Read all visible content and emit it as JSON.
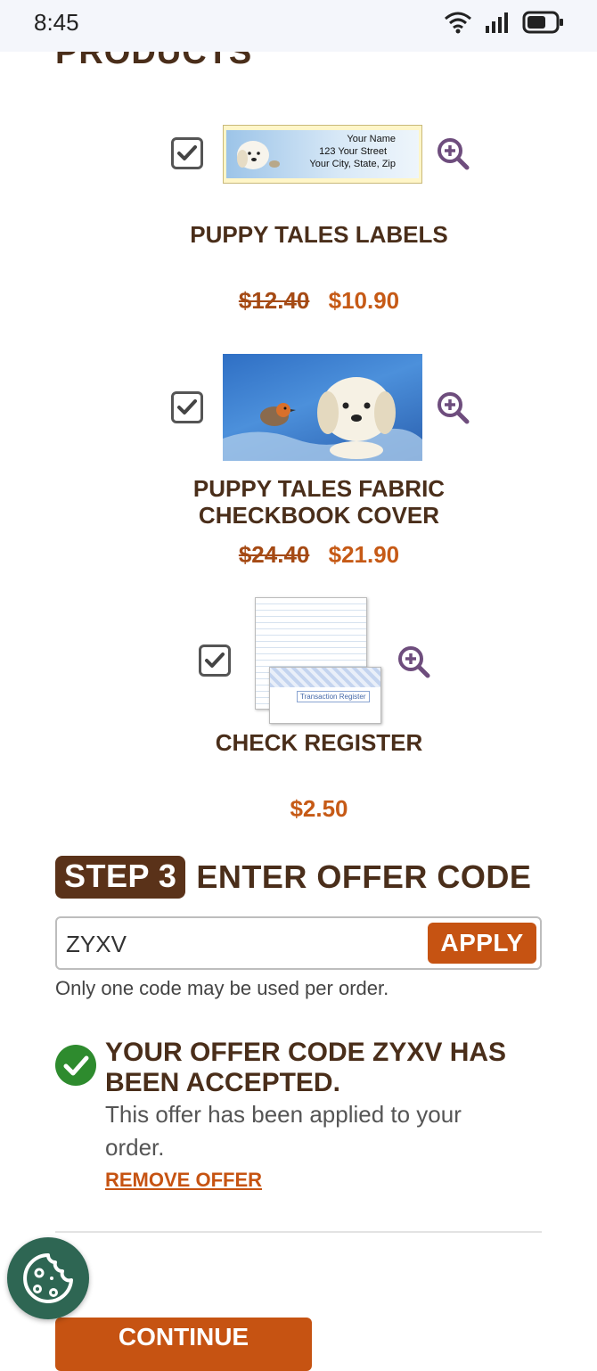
{
  "status": {
    "time": "8:45",
    "icons": [
      "wifi-icon",
      "signal-icon",
      "battery-icon"
    ]
  },
  "section": {
    "title": "PRODUCTS"
  },
  "products": [
    {
      "name": "PUPPY TALES LABELS",
      "old_price": "$12.40",
      "new_price": "$10.90",
      "checked": true,
      "label_lines": [
        "Your Name",
        "123 Your Street",
        "Your City, State, Zip"
      ]
    },
    {
      "name_line1": "PUPPY TALES FABRIC",
      "name_line2": "CHECKBOOK COVER",
      "old_price": "$24.40",
      "new_price": "$21.90",
      "checked": true
    },
    {
      "name": "CHECK REGISTER",
      "price": "$2.50",
      "checked": true,
      "register_caption": "Transaction Register"
    }
  ],
  "step3": {
    "badge": "STEP 3",
    "title": "ENTER OFFER CODE",
    "input_value": "ZYXV",
    "apply_label": "APPLY",
    "note": "Only one code may be used per order."
  },
  "offer": {
    "title": "YOUR OFFER CODE ZYXV HAS BEEN ACCEPTED.",
    "message": "This offer has been applied to your order.",
    "remove_label": "REMOVE OFFER"
  },
  "continue_label": "CONTINUE",
  "colors": {
    "brown": "#4a2e1a",
    "accent": "#c65312",
    "success": "#2e8b2e",
    "cookie": "#2e6653"
  }
}
